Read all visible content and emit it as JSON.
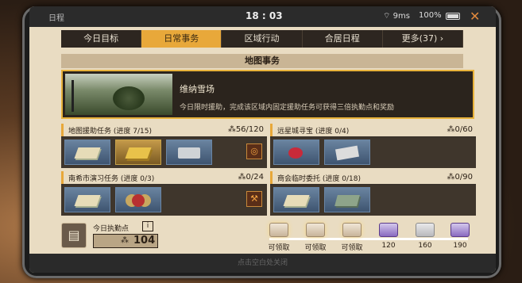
{
  "status": {
    "app": "日程",
    "time": "18 : 03",
    "network": "9ms",
    "battery": "100%"
  },
  "tabs": [
    {
      "label": "今日目标"
    },
    {
      "label": "日常事务",
      "active": true
    },
    {
      "label": "区域行动"
    },
    {
      "label": "合居日程"
    },
    {
      "label": "更多(37)"
    }
  ],
  "section": {
    "title": "地图事务"
  },
  "featured": {
    "title": "维纳雪场",
    "desc": "今日限时援助，完成该区域内固定援助任务可获得三倍执勤点和奖励"
  },
  "cards": [
    {
      "name": "地图援助任务 (进度 7/15)",
      "count": "56/120",
      "items": [
        "map-items",
        "gold-bars",
        "metal-plate"
      ]
    },
    {
      "name": "远星城寻宝 (进度 0/4)",
      "count": "0/60",
      "items": [
        "rubies",
        "foil-pack"
      ]
    },
    {
      "name": "南希市演习任务 (进度 0/3)",
      "count": "0/24",
      "items": [
        "map-items",
        "badge"
      ]
    },
    {
      "name": "商会临时委托 (进度 0/18)",
      "count": "0/90",
      "items": [
        "map-items",
        "cash-bundle"
      ]
    }
  ],
  "duty": {
    "label": "今日执勤点",
    "value": "104",
    "info": "i"
  },
  "rewards": [
    {
      "label": "可领取",
      "color": "cream"
    },
    {
      "label": "可领取",
      "color": "cream"
    },
    {
      "label": "可领取",
      "color": "cream"
    },
    {
      "label": "120",
      "color": "purple"
    },
    {
      "label": "160",
      "color": "grey"
    },
    {
      "label": "190",
      "color": "purple"
    }
  ],
  "hint": "点击空白处关闭"
}
